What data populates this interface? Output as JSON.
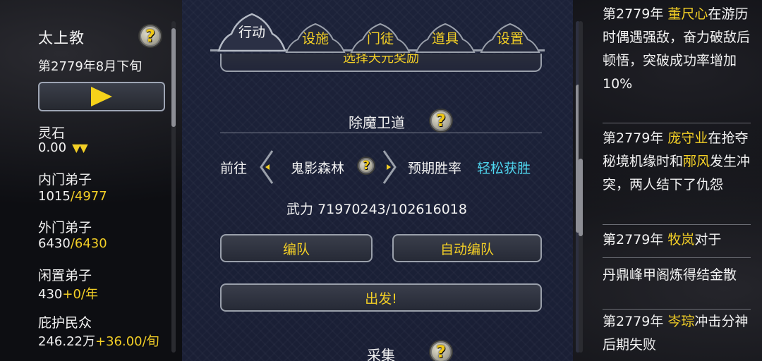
{
  "left": {
    "sect_name": "太上教",
    "date": "第2779年8月下旬",
    "resources": [
      {
        "label": "灵石",
        "value": "0.00",
        "extra": "▼▼"
      },
      {
        "label": "内门弟子",
        "value": "1015",
        "extra": "/4977"
      },
      {
        "label": "外门弟子",
        "value": "6430",
        "extra": "/6430"
      },
      {
        "label": "闲置弟子",
        "value": "430",
        "extra": "+0/年"
      },
      {
        "label": "庇护民众",
        "value": "246.22万",
        "extra": "+36.00/旬"
      }
    ]
  },
  "tabs": [
    {
      "label": "行动",
      "active": true
    },
    {
      "label": "设施"
    },
    {
      "label": "门徒"
    },
    {
      "label": "道具"
    },
    {
      "label": "设置"
    }
  ],
  "center": {
    "cut_button_label": "选择天元奖励",
    "mission_title": "除魔卫道",
    "goto_label": "前往",
    "location": "鬼影森林",
    "win_rate_label": "预期胜率",
    "win_rate_value": "轻松获胜",
    "power_label": "武力",
    "power_value": "71970243/102616018",
    "formation_btn": "编队",
    "auto_formation_btn": "自动编队",
    "depart_btn": "出发!",
    "next_title": "采集"
  },
  "log": [
    {
      "year": "第2779年",
      "name": "董尺心",
      "text1": "在",
      "rest": "游历时偶遇强敌，奋力破敌后顿悟，突破成功率增加10%"
    },
    {
      "year": "第2779年",
      "name": "庞守业",
      "text1": "在",
      "rest": "抢夺秘境机缘时和",
      "name2": "邴风",
      "rest2": "发生冲突，两人结下了仇怨"
    },
    {
      "year": "第2779年",
      "name": "牧岚",
      "text1": "对于",
      "rest": "丹鼎峰甲阁炼得结金散"
    },
    {
      "year": "第2779年",
      "name": "岑琮",
      "text1": "冲击",
      "rest": "分神后期失败"
    }
  ]
}
